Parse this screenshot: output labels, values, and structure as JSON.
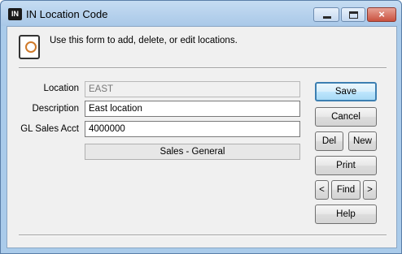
{
  "window": {
    "app_badge": "IN",
    "title": "IN Location Code",
    "close_glyph": "×"
  },
  "header": {
    "icon": "form-document-icon",
    "text": "Use this form to add, delete, or edit locations."
  },
  "form": {
    "location": {
      "label": "Location",
      "value": "EAST",
      "disabled": true
    },
    "description": {
      "label": "Description",
      "value": "East location"
    },
    "gl_sales_acct": {
      "label": "GL Sales Acct",
      "value": "4000000"
    },
    "gl_account_name": "Sales - General"
  },
  "buttons": {
    "save": "Save",
    "cancel": "Cancel",
    "del": "Del",
    "new": "New",
    "print": "Print",
    "prev": "<",
    "find": "Find",
    "next": ">",
    "help": "Help"
  },
  "colors": {
    "titlebar": "#aacbea",
    "default_button_border": "#3c7fb1",
    "close_button": "#c9513f"
  }
}
